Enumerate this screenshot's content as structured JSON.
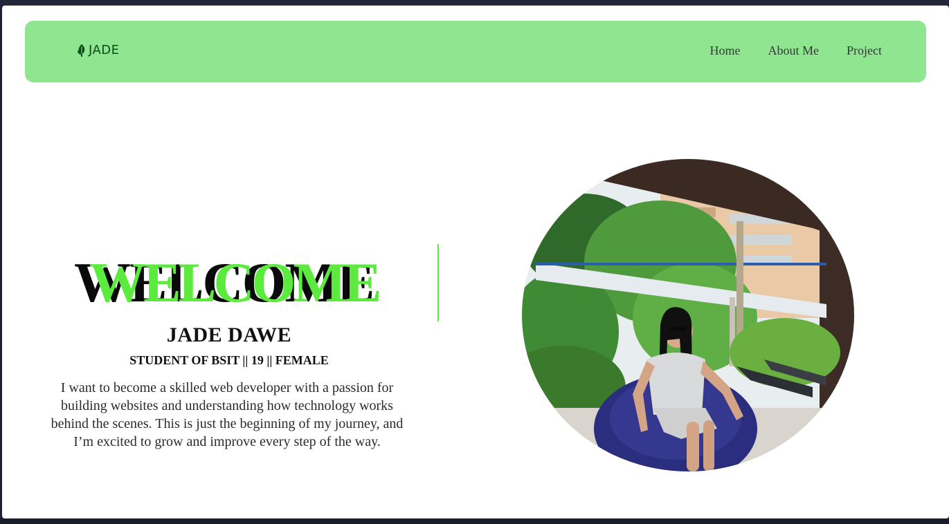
{
  "brand": {
    "logo_icon": "leaf-icon",
    "name": "JADE",
    "color": "#0c4a1e"
  },
  "nav": {
    "background": "#90e591",
    "items": [
      {
        "label": "Home"
      },
      {
        "label": "About Me"
      },
      {
        "label": "Project"
      }
    ]
  },
  "hero": {
    "welcome": "WELCOME",
    "welcome_colors": {
      "front": "#5bea3d",
      "back": "#0a0a0a"
    },
    "name": "JADE DAWE",
    "subtitle": "STUDENT OF BSIT || 19 || FEMALE",
    "bio": "I want to become a skilled web developer with a passion for building websites and understanding how technology works behind the scenes. This is just the beginning of my journey, and I’m excited to grow and improve every step of the way."
  },
  "profile_photo": {
    "description_icon": "profile-photo"
  }
}
